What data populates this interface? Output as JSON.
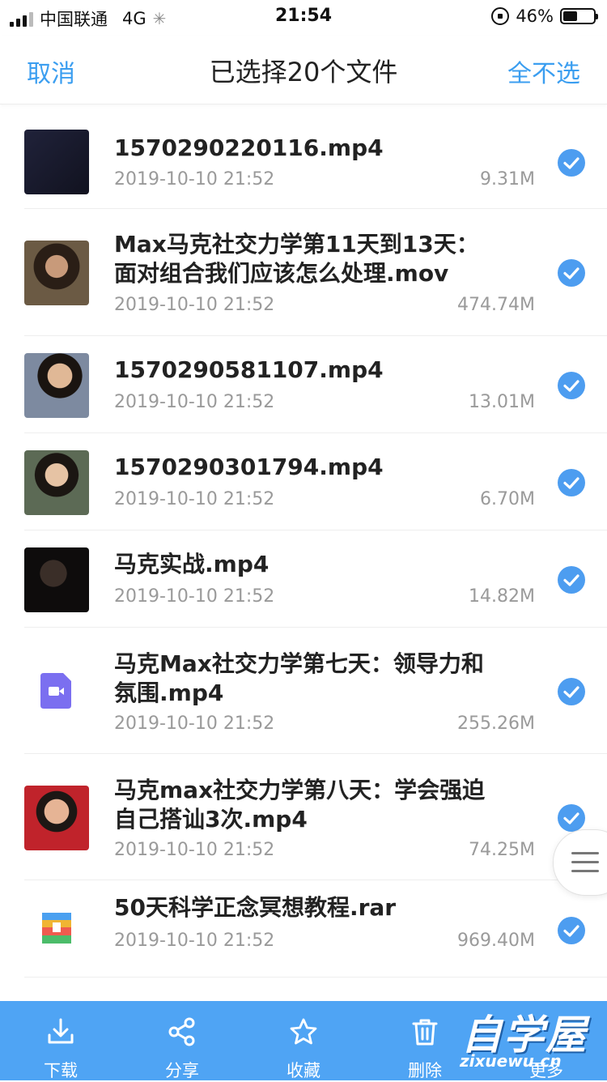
{
  "status_bar": {
    "carrier": "中国联通",
    "network": "4G",
    "time": "21:54",
    "battery_percent": "46%",
    "battery_level": 0.46
  },
  "nav": {
    "cancel": "取消",
    "title": "已选择20个文件",
    "deselect_all": "全不选"
  },
  "files": [
    {
      "name": "1570290220116.mp4",
      "date": "2019-10-10 21:52",
      "size": "9.31M",
      "thumb": "video-thumbnail",
      "checked": true
    },
    {
      "name": "Max马克社交力学第11天到13天：面对组合我们应该怎么处理.mov",
      "date": "2019-10-10 21:52",
      "size": "474.74M",
      "thumb": "video-thumbnail",
      "checked": true
    },
    {
      "name": "1570290581107.mp4",
      "date": "2019-10-10 21:52",
      "size": "13.01M",
      "thumb": "video-thumbnail",
      "checked": true
    },
    {
      "name": "1570290301794.mp4",
      "date": "2019-10-10 21:52",
      "size": "6.70M",
      "thumb": "video-thumbnail",
      "checked": true
    },
    {
      "name": "马克实战.mp4",
      "date": "2019-10-10 21:52",
      "size": "14.82M",
      "thumb": "video-thumbnail",
      "checked": true
    },
    {
      "name": "马克Max社交力学第七天：领导力和氛围.mp4",
      "date": "2019-10-10 21:52",
      "size": "255.26M",
      "thumb": "video-file-icon",
      "checked": true
    },
    {
      "name": "马克max社交力学第八天：学会强迫自己搭讪3次.mp4",
      "date": "2019-10-10 21:52",
      "size": "74.25M",
      "thumb": "video-thumbnail",
      "checked": true
    },
    {
      "name": "50天科学正念冥想教程.rar",
      "date": "2019-10-10 21:52",
      "size": "969.40M",
      "thumb": "archive-file-icon",
      "checked": true
    }
  ],
  "toolbar": {
    "download": "下载",
    "share": "分享",
    "favorite": "收藏",
    "delete": "删除",
    "more": "更多"
  },
  "watermark": {
    "title": "自学屋",
    "url": "zixuewu.cn"
  },
  "colors": {
    "accent": "#3b9ef0",
    "check": "#4d9df0",
    "toolbar": "#4fa4f4",
    "meta_text": "#9a9a9a"
  }
}
